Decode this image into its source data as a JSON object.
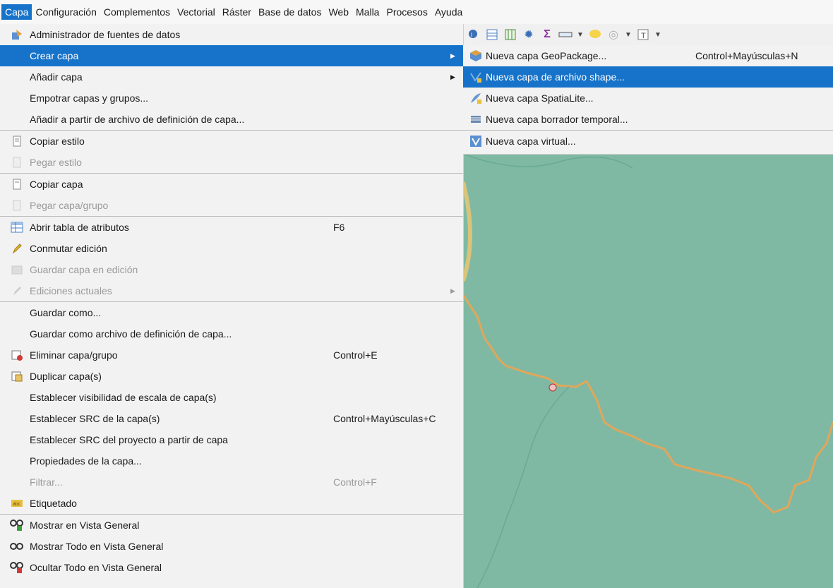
{
  "menubar": {
    "items": [
      "Capa",
      "Configuración",
      "Complementos",
      "Vectorial",
      "Ráster",
      "Base de datos",
      "Web",
      "Malla",
      "Procesos",
      "Ayuda"
    ]
  },
  "layer_menu": {
    "items": [
      {
        "label": "Administrador de fuentes de datos",
        "icon": "data-source-manager-icon"
      },
      {
        "label": "Crear capa",
        "submenu": true,
        "highlighted": true
      },
      {
        "label": "Añadir capa",
        "submenu": true
      },
      {
        "label": "Empotrar capas y grupos..."
      },
      {
        "label": "Añadir a partir de archivo de definición de capa..."
      },
      {
        "label": "Copiar estilo",
        "icon": "copy-style-icon"
      },
      {
        "label": "Pegar estilo",
        "icon": "paste-style-icon",
        "disabled": true
      },
      {
        "label": "Copiar capa",
        "icon": "copy-layer-icon"
      },
      {
        "label": "Pegar capa/grupo",
        "icon": "paste-layer-icon",
        "disabled": true
      },
      {
        "label": "Abrir tabla de atributos",
        "icon": "attribute-table-icon",
        "shortcut": "F6"
      },
      {
        "label": "Conmutar edición",
        "icon": "pencil-icon"
      },
      {
        "label": "Guardar capa en edición",
        "icon": "save-edits-icon",
        "disabled": true
      },
      {
        "label": "Ediciones actuales",
        "icon": "current-edits-icon",
        "disabled": true,
        "submenu": true
      },
      {
        "label": "Guardar como..."
      },
      {
        "label": "Guardar como archivo de definición de capa..."
      },
      {
        "label": "Eliminar capa/grupo",
        "icon": "remove-layer-icon",
        "shortcut": "Control+E"
      },
      {
        "label": "Duplicar capa(s)",
        "icon": "duplicate-layer-icon"
      },
      {
        "label": "Establecer visibilidad de escala de capa(s)"
      },
      {
        "label": "Establecer SRC de la capa(s)",
        "shortcut": "Control+Mayúsculas+C"
      },
      {
        "label": "Establecer SRC del proyecto a partir de capa"
      },
      {
        "label": "Propiedades de la capa..."
      },
      {
        "label": "Filtrar...",
        "disabled": true,
        "shortcut": "Control+F"
      },
      {
        "label": "Etiquetado",
        "icon": "labeling-icon"
      },
      {
        "label": "Mostrar en Vista General",
        "icon": "overview-show-icon"
      },
      {
        "label": "Mostrar Todo en Vista General",
        "icon": "overview-all-icon"
      },
      {
        "label": "Ocultar Todo en Vista General",
        "icon": "overview-hide-icon"
      }
    ]
  },
  "create_layer_submenu": {
    "items": [
      {
        "label": "Nueva capa GeoPackage...",
        "shortcut": "Control+Mayúsculas+N",
        "icon": "geopackage-icon"
      },
      {
        "label": "Nueva capa de archivo shape...",
        "highlighted": true,
        "icon": "shapefile-icon"
      },
      {
        "label": "Nueva capa SpatiaLite...",
        "icon": "spatialite-icon"
      },
      {
        "label": "Nueva capa borrador temporal...",
        "icon": "scratch-layer-icon"
      },
      {
        "label": "Nueva capa virtual...",
        "icon": "virtual-layer-icon"
      }
    ]
  },
  "toolbar": {
    "icons": [
      "identify-icon",
      "table-icon",
      "grid-icon",
      "gear-icon",
      "sum-icon",
      "measure-icon",
      "tooltip-icon",
      "zoom-icon",
      "text-annotation-icon"
    ]
  },
  "colors": {
    "menu_highlight": "#1773c9",
    "map_water": "#7fb9a4",
    "river": "#e0a75a"
  }
}
